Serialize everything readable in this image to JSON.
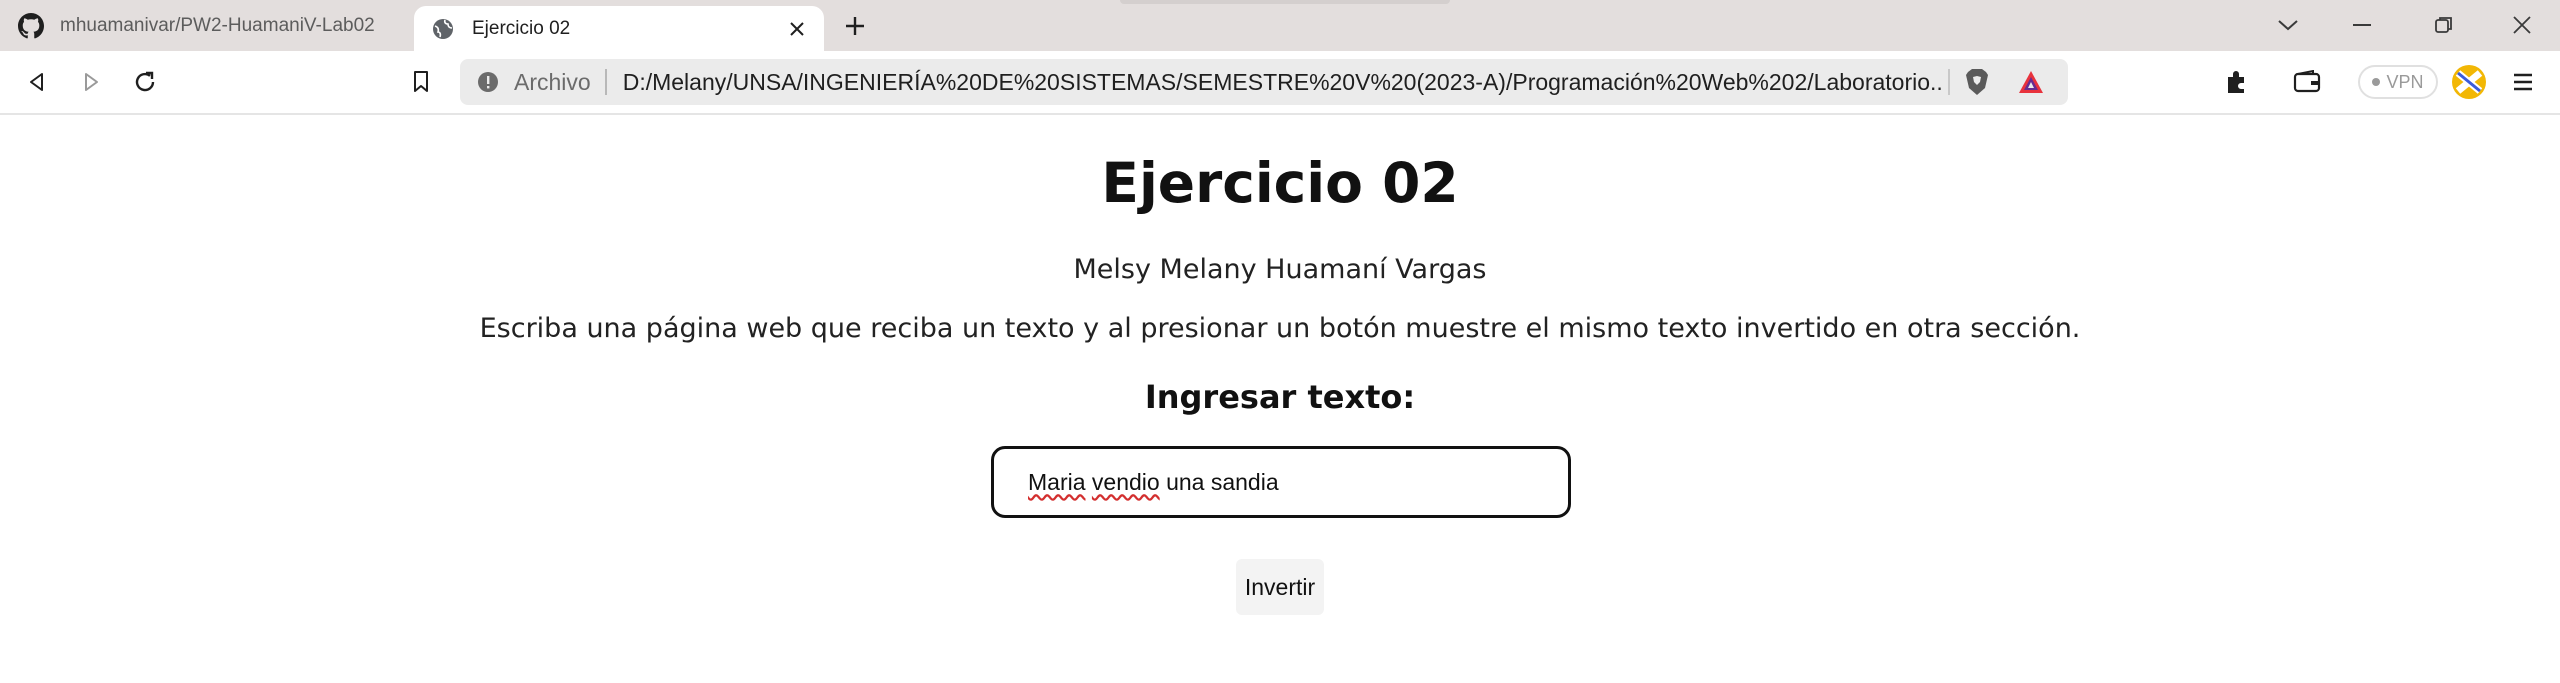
{
  "tabs": [
    {
      "title": "mhuamanivar/PW2-HuamaniV-Lab02",
      "favicon": "github-icon",
      "active": false
    },
    {
      "title": "Ejercicio 02",
      "favicon": "globe-icon",
      "active": true
    }
  ],
  "omnibox": {
    "scheme": "Archivo",
    "url": "D:/Melany/UNSA/INGENIERÍA%20DE%20SISTEMAS/SEMESTRE%20V%20(2023-A)/Programación%20Web%202/Laboratorio..."
  },
  "toolbar": {
    "vpn_label": "VPN"
  },
  "page": {
    "heading": "Ejercicio 02",
    "author": "Melsy Melany Huamaní Vargas",
    "description": "Escriba una página web que reciba un texto y al presionar un botón muestre el mismo texto invertido en otra sección.",
    "input_label": "Ingresar texto:",
    "input_value_words": [
      "Maria",
      "vendio",
      "una sandia"
    ],
    "button_label": "Invertir"
  },
  "colors": {
    "tabstrip_bg": "#e3dedd",
    "omnibox_bg": "#ebebeb",
    "spellcheck": "#d32f2f",
    "brave_orange": "#5a5a5a",
    "bat_red": "#e8323c",
    "bat_purple": "#662d91"
  }
}
